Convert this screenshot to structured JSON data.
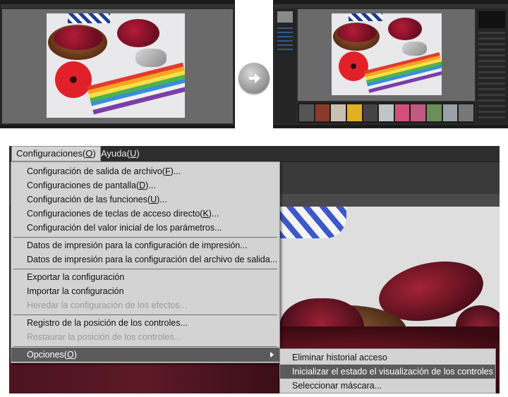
{
  "menubar": {
    "items": [
      {
        "label": "Configuraciones(",
        "key": "O",
        "suffix": ")"
      },
      {
        "label": "Ayuda(",
        "key": "U",
        "suffix": ")"
      }
    ]
  },
  "dropdown": {
    "items": [
      {
        "pre": "Configuración de salida de archivo(",
        "key": "F",
        "post": ")..."
      },
      {
        "pre": "Configuraciones de pantalla(",
        "key": "D",
        "post": ")..."
      },
      {
        "pre": "Configuración de las funciones(",
        "key": "U",
        "post": ")..."
      },
      {
        "pre": "Configuraciones de teclas de acceso directo(",
        "key": "K",
        "post": ")..."
      },
      {
        "pre": "Configuración del valor inicial de los parámetros...",
        "key": "",
        "post": ""
      },
      {
        "pre": "Datos de impresión para la configuración de impresión...",
        "key": "",
        "post": ""
      },
      {
        "pre": "Datos de impresión para la configuración del archivo de salida...",
        "key": "",
        "post": ""
      },
      {
        "pre": "Exportar la configuración",
        "key": "",
        "post": ""
      },
      {
        "pre": "Importar la configuración",
        "key": "",
        "post": ""
      },
      {
        "pre": "Heredar la configuración de los efectos...",
        "key": "",
        "post": ""
      },
      {
        "pre": "Registro de la posición de los controles...",
        "key": "",
        "post": ""
      },
      {
        "pre": "Restaurar la posición de los controles...",
        "key": "",
        "post": ""
      },
      {
        "pre": "Opciones(",
        "key": "O",
        "post": ")"
      }
    ]
  },
  "submenu": {
    "items": [
      "Eliminar historial acceso",
      "Inicializar el estado el visualización de los controles",
      "Seleccionar máscara..."
    ]
  },
  "colors": {
    "menu_bg": "#d3d3d3",
    "highlight": "#5b5b5b",
    "disabled_text": "#9a9a9a",
    "app_dark": "#2e2e2e"
  },
  "icons": {
    "transition": "arrow-right-icon",
    "submenu": "submenu-arrow-icon"
  }
}
